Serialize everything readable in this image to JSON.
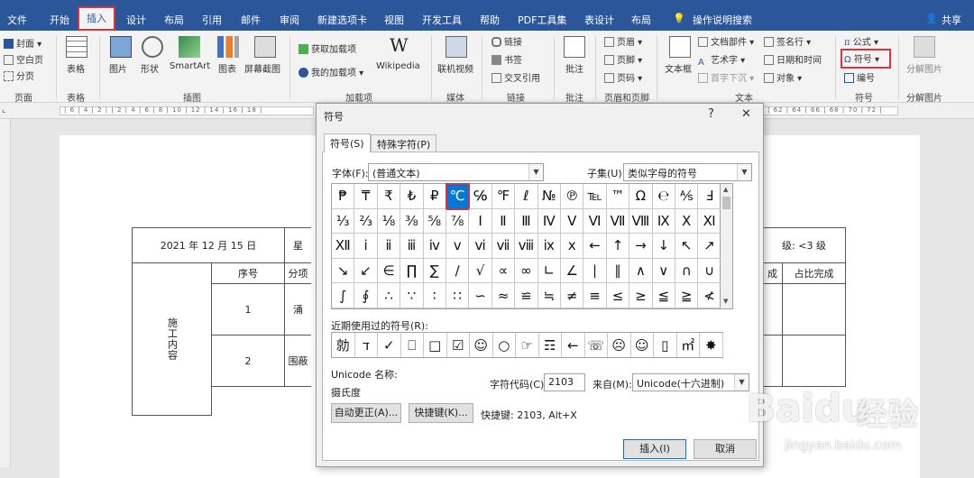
{
  "tabs": [
    "文件",
    "开始",
    "插入",
    "设计",
    "布局",
    "引用",
    "邮件",
    "审阅",
    "新建选项卡",
    "视图",
    "开发工具",
    "帮助",
    "PDF工具集",
    "表设计",
    "布局"
  ],
  "tell_me": "操作说明搜索",
  "share": "共享",
  "ribbon": {
    "pages": {
      "cover": "封面",
      "blank": "空白页",
      "break": "分页",
      "label": "页面"
    },
    "tables": {
      "table": "表格",
      "label": "表格"
    },
    "illus": {
      "pictures": "图片",
      "shapes": "形状",
      "smartart": "SmartArt",
      "chart": "图表",
      "screenshot": "屏幕截图",
      "label": "插图"
    },
    "addins": {
      "get": "获取加载项",
      "my": "我的加载项",
      "wiki": "Wikipedia",
      "label": "加载项"
    },
    "media": {
      "video": "联机视频",
      "label": "媒体"
    },
    "links": {
      "link": "链接",
      "bookmark": "书签",
      "xref": "交叉引用",
      "label": "链接"
    },
    "comments": {
      "comment": "批注",
      "label": "批注"
    },
    "hf": {
      "header": "页眉",
      "footer": "页脚",
      "pagenum": "页码",
      "label": "页眉和页脚"
    },
    "text": {
      "textbox": "文本框",
      "parts": "文档部件",
      "wordart": "艺术字",
      "dropcap": "首字下沉",
      "sigline": "签名行",
      "datetime": "日期和时间",
      "object": "对象",
      "label": "文本"
    },
    "symbols": {
      "equation": "公式",
      "symbol": "符号",
      "number": "编号",
      "label": "符号"
    },
    "split": {
      "splitpic": "分解图片",
      "label": "分解图片"
    }
  },
  "document": {
    "date": "2021 年 12 月 15 日",
    "star": "星",
    "level": "级: <3 级",
    "seq": "序号",
    "item": "分项",
    "done": "成",
    "ratio": "占比完成",
    "section": "施工内容",
    "row1": "1",
    "row1_text": "涌",
    "row2": "2",
    "row2_text": "围蔽"
  },
  "dialog": {
    "title": "符号",
    "help": "?",
    "close": "✕",
    "tab1": "符号(S)",
    "tab2": "特殊字符(P)",
    "font_label": "字体(F):",
    "font_value": "(普通文本)",
    "subset_label": "子集(U):",
    "subset_value": "类似字母的符号",
    "symbols": [
      [
        "₱",
        "₸",
        "₹",
        "₺",
        "₽",
        "℃",
        "℅",
        "℉",
        "ℓ",
        "№",
        "℗",
        "℡",
        "™",
        "Ω",
        "℮",
        "⅍",
        "Ⅎ"
      ],
      [
        "⅓",
        "⅔",
        "⅛",
        "⅜",
        "⅝",
        "⅞",
        "Ⅰ",
        "Ⅱ",
        "Ⅲ",
        "Ⅳ",
        "Ⅴ",
        "Ⅵ",
        "Ⅶ",
        "Ⅷ",
        "Ⅸ",
        "Ⅹ",
        "Ⅺ"
      ],
      [
        "Ⅻ",
        "ⅰ",
        "ⅱ",
        "ⅲ",
        "ⅳ",
        "ⅴ",
        "ⅵ",
        "ⅶ",
        "ⅷ",
        "ⅸ",
        "ⅹ",
        "←",
        "↑",
        "→",
        "↓",
        "↖",
        "↗"
      ],
      [
        "↘",
        "↙",
        "∈",
        "∏",
        "∑",
        "∕",
        "√",
        "∝",
        "∞",
        "∟",
        "∠",
        "∣",
        "∥",
        "∧",
        "∨",
        "∩",
        "∪"
      ],
      [
        "∫",
        "∮",
        "∴",
        "∵",
        "∶",
        "∷",
        "∽",
        "≈",
        "≌",
        "≒",
        "≠",
        "≡",
        "≤",
        "≥",
        "≦",
        "≧",
        "≮"
      ]
    ],
    "selected": "℃",
    "recent_label": "近期使用过的符号(R):",
    "recent": [
      "勍",
      "ד",
      "✓",
      "⎕",
      "□",
      "☑",
      "☺",
      "○",
      "☞",
      "☶",
      "←",
      "☏",
      "☹",
      "☺",
      "▯",
      "㎡",
      "✸"
    ],
    "unicode_name_label": "Unicode 名称:",
    "unicode_name": "摄氏度",
    "code_label": "字符代码(C):",
    "code_value": "2103",
    "from_label": "来自(M):",
    "from_value": "Unicode(十六进制)",
    "autocorrect": "自动更正(A)...",
    "shortcut_btn": "快捷键(K)...",
    "shortcut_text": "快捷键: 2103, Alt+X",
    "insert": "插入(I)",
    "cancel": "取消"
  },
  "ruler_ticks": "| 6 | 4 | 2 |   | 2 | 4 | 6 | 8 | 10 | 12 | 14 | 16 | 18 |",
  "ruler_ticks2": "| 62 | 64 | 66 | 68 | 70 | 72 |",
  "watermark": {
    "brand": "Baidu",
    "cn": "经验",
    "url": "jingyan.baidu.com"
  }
}
